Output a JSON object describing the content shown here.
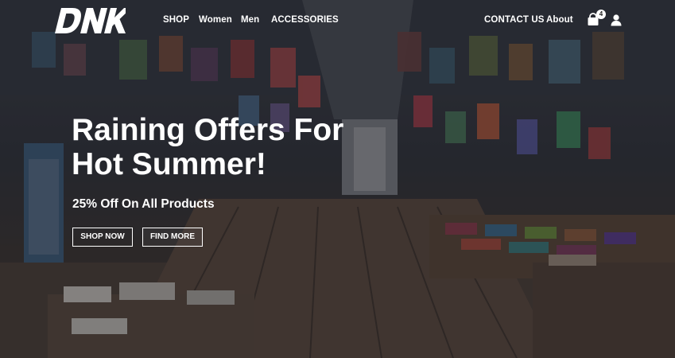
{
  "brand": {
    "logo_text": "DNK"
  },
  "nav": {
    "left": [
      "SHOP",
      "Women",
      "Men",
      "ACCESSORIES"
    ],
    "right": [
      "CONTACT US",
      "About"
    ]
  },
  "cart": {
    "count": "4",
    "icon": "shopping-bag-icon"
  },
  "account": {
    "icon": "user-icon"
  },
  "hero": {
    "headline_line1": "Raining Offers For",
    "headline_line2": "Hot Summer!",
    "subheading": "25% Off On All Products",
    "primary_button": "SHOP NOW",
    "secondary_button": "FIND MORE"
  },
  "colors": {
    "text": "#ffffff",
    "overlay": "#1d2026"
  }
}
